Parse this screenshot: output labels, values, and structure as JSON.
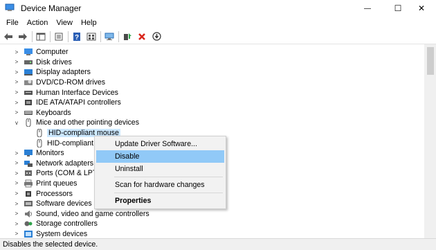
{
  "window": {
    "title": "Device Manager",
    "minimize_glyph": "—",
    "maximize_glyph": "☐",
    "close_glyph": "✕"
  },
  "menu": [
    "File",
    "Action",
    "View",
    "Help"
  ],
  "toolbar": {
    "buttons": [
      "back-arrow-icon",
      "forward-arrow-icon",
      "show-hide-console-tree-icon",
      "properties-icon",
      "help-icon",
      "view-icon",
      "scan-hardware-icon",
      "update-driver-icon",
      "uninstall-icon",
      "disable-icon"
    ]
  },
  "tree": {
    "items": [
      {
        "label": "Computer",
        "expanded": false,
        "icon": "computer-icon"
      },
      {
        "label": "Disk drives",
        "expanded": false,
        "icon": "disk-drive-icon"
      },
      {
        "label": "Display adapters",
        "expanded": false,
        "icon": "display-adapter-icon"
      },
      {
        "label": "DVD/CD-ROM drives",
        "expanded": false,
        "icon": "dvd-drive-icon"
      },
      {
        "label": "Human Interface Devices",
        "expanded": false,
        "icon": "hid-icon"
      },
      {
        "label": "IDE ATA/ATAPI controllers",
        "expanded": false,
        "icon": "ide-controller-icon"
      },
      {
        "label": "Keyboards",
        "expanded": false,
        "icon": "keyboard-icon"
      },
      {
        "label": "Mice and other pointing devices",
        "expanded": true,
        "icon": "mouse-icon"
      },
      {
        "label": "HID-compliant mouse",
        "child": true,
        "selected": true,
        "icon": "mouse-icon"
      },
      {
        "label": "HID-compliant m",
        "child": true,
        "icon": "mouse-icon"
      },
      {
        "label": "Monitors",
        "expanded": false,
        "icon": "monitor-icon"
      },
      {
        "label": "Network adapters",
        "expanded": false,
        "icon": "network-adapter-icon"
      },
      {
        "label": "Ports (COM & LPT)",
        "expanded": false,
        "icon": "port-icon"
      },
      {
        "label": "Print queues",
        "expanded": false,
        "icon": "printer-icon"
      },
      {
        "label": "Processors",
        "expanded": false,
        "icon": "processor-icon"
      },
      {
        "label": "Software devices",
        "expanded": false,
        "icon": "software-device-icon"
      },
      {
        "label": "Sound, video and game controllers",
        "expanded": false,
        "icon": "sound-icon"
      },
      {
        "label": "Storage controllers",
        "expanded": false,
        "icon": "storage-controller-icon"
      },
      {
        "label": "System devices",
        "expanded": false,
        "icon": "system-device-icon"
      }
    ]
  },
  "context_menu": {
    "items": [
      {
        "label": "Update Driver Software...",
        "highlighted": false,
        "bold": false
      },
      {
        "label": "Disable",
        "highlighted": true,
        "bold": false
      },
      {
        "label": "Uninstall",
        "highlighted": false,
        "bold": false
      },
      {
        "label": "Scan for hardware changes",
        "highlighted": false,
        "bold": false
      },
      {
        "label": "Properties",
        "highlighted": false,
        "bold": true
      }
    ]
  },
  "status": {
    "text": "Disables the selected device."
  },
  "colors": {
    "selection": "#cce8ff",
    "menu_highlight": "#91c9f7",
    "disable_red": "#d9261c",
    "icon_blue": "#1f7fd6"
  }
}
